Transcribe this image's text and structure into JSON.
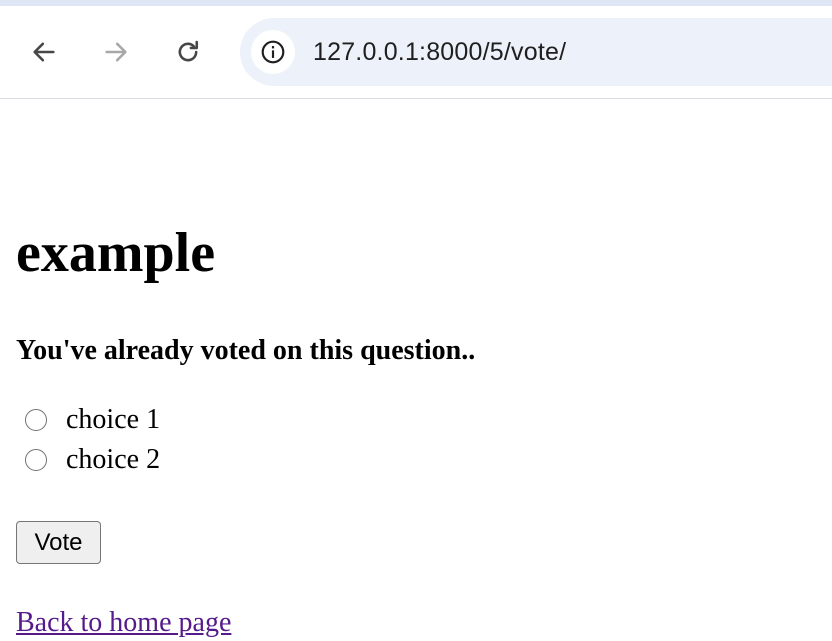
{
  "browser": {
    "url": "127.0.0.1:8000/5/vote/",
    "back_icon": "arrow-left-icon",
    "forward_icon": "arrow-right-icon",
    "reload_icon": "reload-icon",
    "site_info_icon": "info-icon"
  },
  "page": {
    "heading": "example",
    "error_message": "You've already voted on this question..",
    "choices": [
      {
        "label": "choice 1"
      },
      {
        "label": "choice 2"
      }
    ],
    "vote_button_label": "Vote",
    "back_link_label": "Back to home page"
  }
}
